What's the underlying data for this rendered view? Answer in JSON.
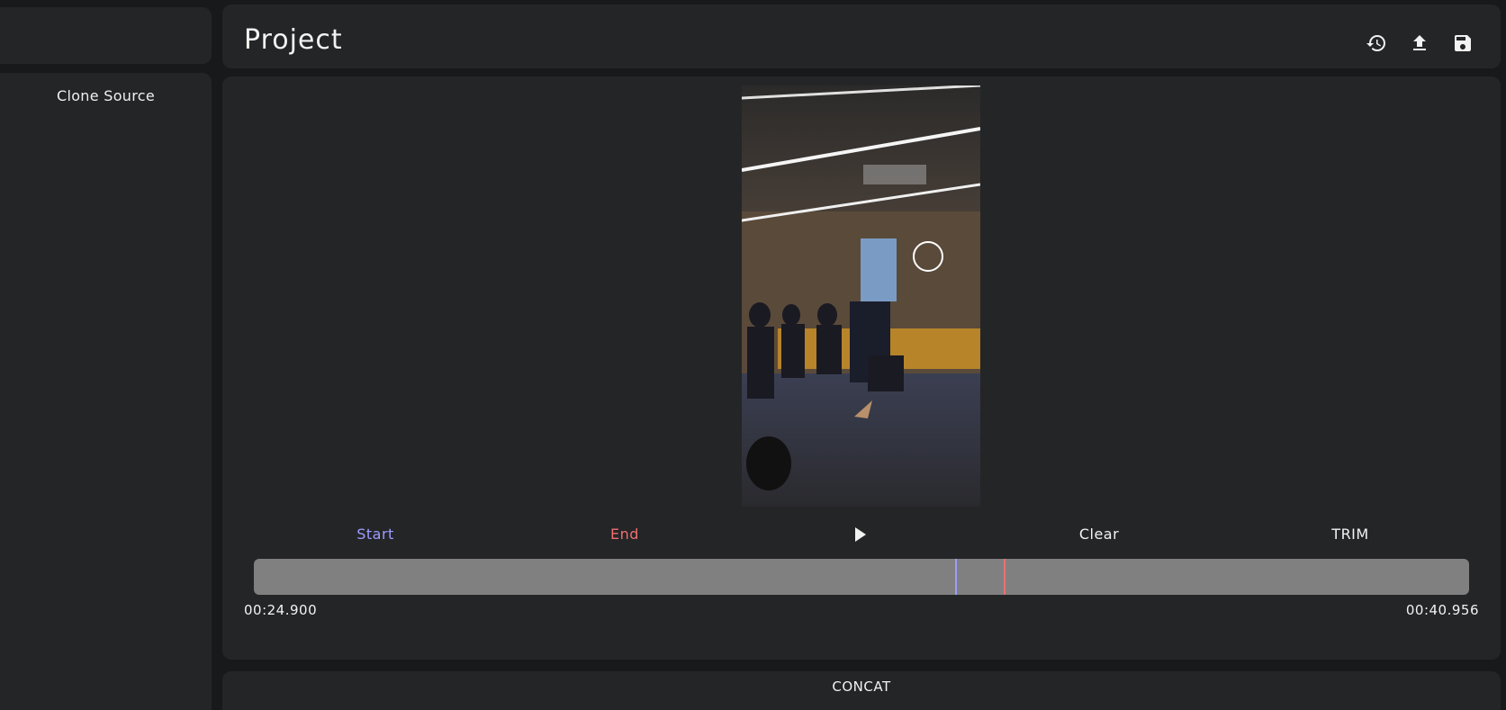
{
  "sidebar": {
    "items": [
      {
        "label": "Clone Source"
      }
    ]
  },
  "header": {
    "title": "Project",
    "icons": [
      "history-icon",
      "upload-icon",
      "save-icon"
    ]
  },
  "editor": {
    "controls": {
      "start_label": "Start",
      "end_label": "End",
      "play_icon": "play-icon",
      "clear_label": "Clear",
      "trim_label": "TRIM"
    },
    "timeline": {
      "start_time": "00:24.900",
      "end_time": "00:40.956",
      "start_marker_fraction": 0.577,
      "end_marker_fraction": 0.617
    },
    "colors": {
      "start": "#9d9dff",
      "end": "#ef6f6f",
      "track": "#808080"
    }
  },
  "concat": {
    "label": "CONCAT"
  }
}
